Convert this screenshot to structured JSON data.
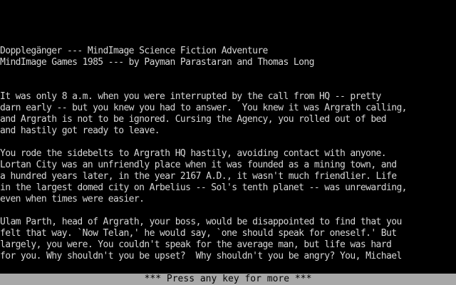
{
  "header": {
    "title_line": "Dopplegänger --- MindImage Science Fiction Adventure",
    "credits_line": "MindImage Games 1985 --- by Payman Parastaran and Thomas Long"
  },
  "story": {
    "paragraph1": [
      "It was only 8 a.m. when you were interrupted by the call from HQ -- pretty",
      "darn early -- but you knew you had to answer.  You knew it was Argrath calling,",
      "and Argrath is not to be ignored. Cursing the Agency, you rolled out of bed",
      "and hastily got ready to leave."
    ],
    "paragraph2": [
      "You rode the sidebelts to Argrath HQ hastily, avoiding contact with anyone.",
      "Lortan City was an unfriendly place when it was founded as a mining town, and",
      "a hundred years later, in the year 2167 A.D., it wasn't much friendlier. Life",
      "in the largest domed city on Arbelius -- Sol's tenth planet -- was unrewarding,",
      "even when times were easier."
    ],
    "paragraph3": [
      "Ulam Parth, head of Argrath, your boss, would be disappointed to find that you",
      "felt that way. `Now Telan,' he would say, `one should speak for oneself.' But",
      "largely, you were. You couldn't speak for the average man, but life was hard",
      "for you. Why shouldn't you be upset?  Why shouldn't you be angry? You, Michael"
    ]
  },
  "status_bar": {
    "prompt": "*** Press any key for more ***"
  },
  "colors": {
    "background": "#000000",
    "text": "#d6d6d6",
    "status_bar_bg": "#a8a8a8",
    "status_bar_text": "#000000"
  }
}
